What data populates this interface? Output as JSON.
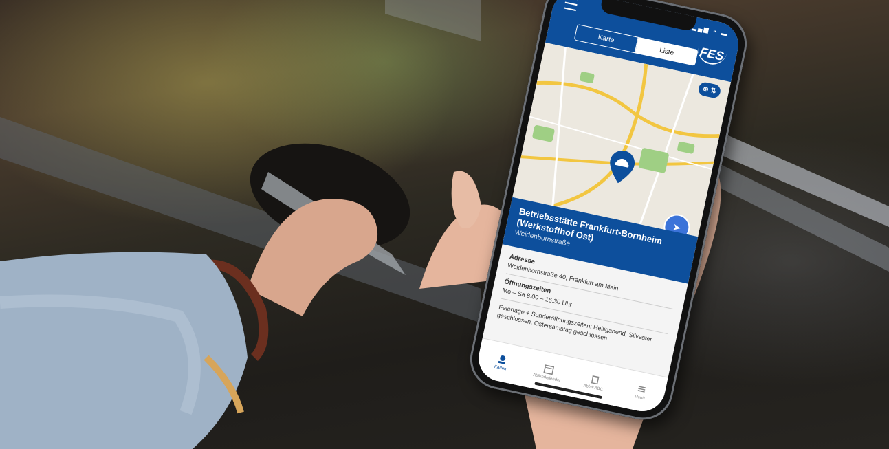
{
  "app": {
    "logo_text": "FES",
    "segmented": {
      "map_label": "Karte",
      "list_label": "Liste"
    },
    "filter_button_label": "⊕ ⇅"
  },
  "location": {
    "title": "Betriebsstätte Frankfurt-Bornheim (Werkstoffhof Ost)",
    "subtitle": "Weidenbornstraße"
  },
  "info": {
    "address_label": "Adresse",
    "address_value": "Weidenbornstraße 40, Frankfurt am Main",
    "hours_label": "Öffnungszeiten",
    "hours_value": "Mo – Sa 8.00 – 16.30 Uhr",
    "holiday_note": "Feiertage + Sonderöffnungszeiten: Heiligabend, Silvester geschlossen, Ostersamstag geschlossen"
  },
  "tabs": [
    {
      "label": "Karten",
      "icon": "map-pin-icon",
      "active": true
    },
    {
      "label": "Abfuhrkalender",
      "icon": "calendar-icon",
      "active": false
    },
    {
      "label": "Abfall ABC",
      "icon": "bin-icon",
      "active": false
    },
    {
      "label": "Menü",
      "icon": "menu-icon",
      "active": false
    }
  ],
  "colors": {
    "brand_blue": "#0d4f9c",
    "fab_blue": "#3b73d9",
    "map_road": "#f2c641",
    "map_park": "#9fcf84"
  }
}
